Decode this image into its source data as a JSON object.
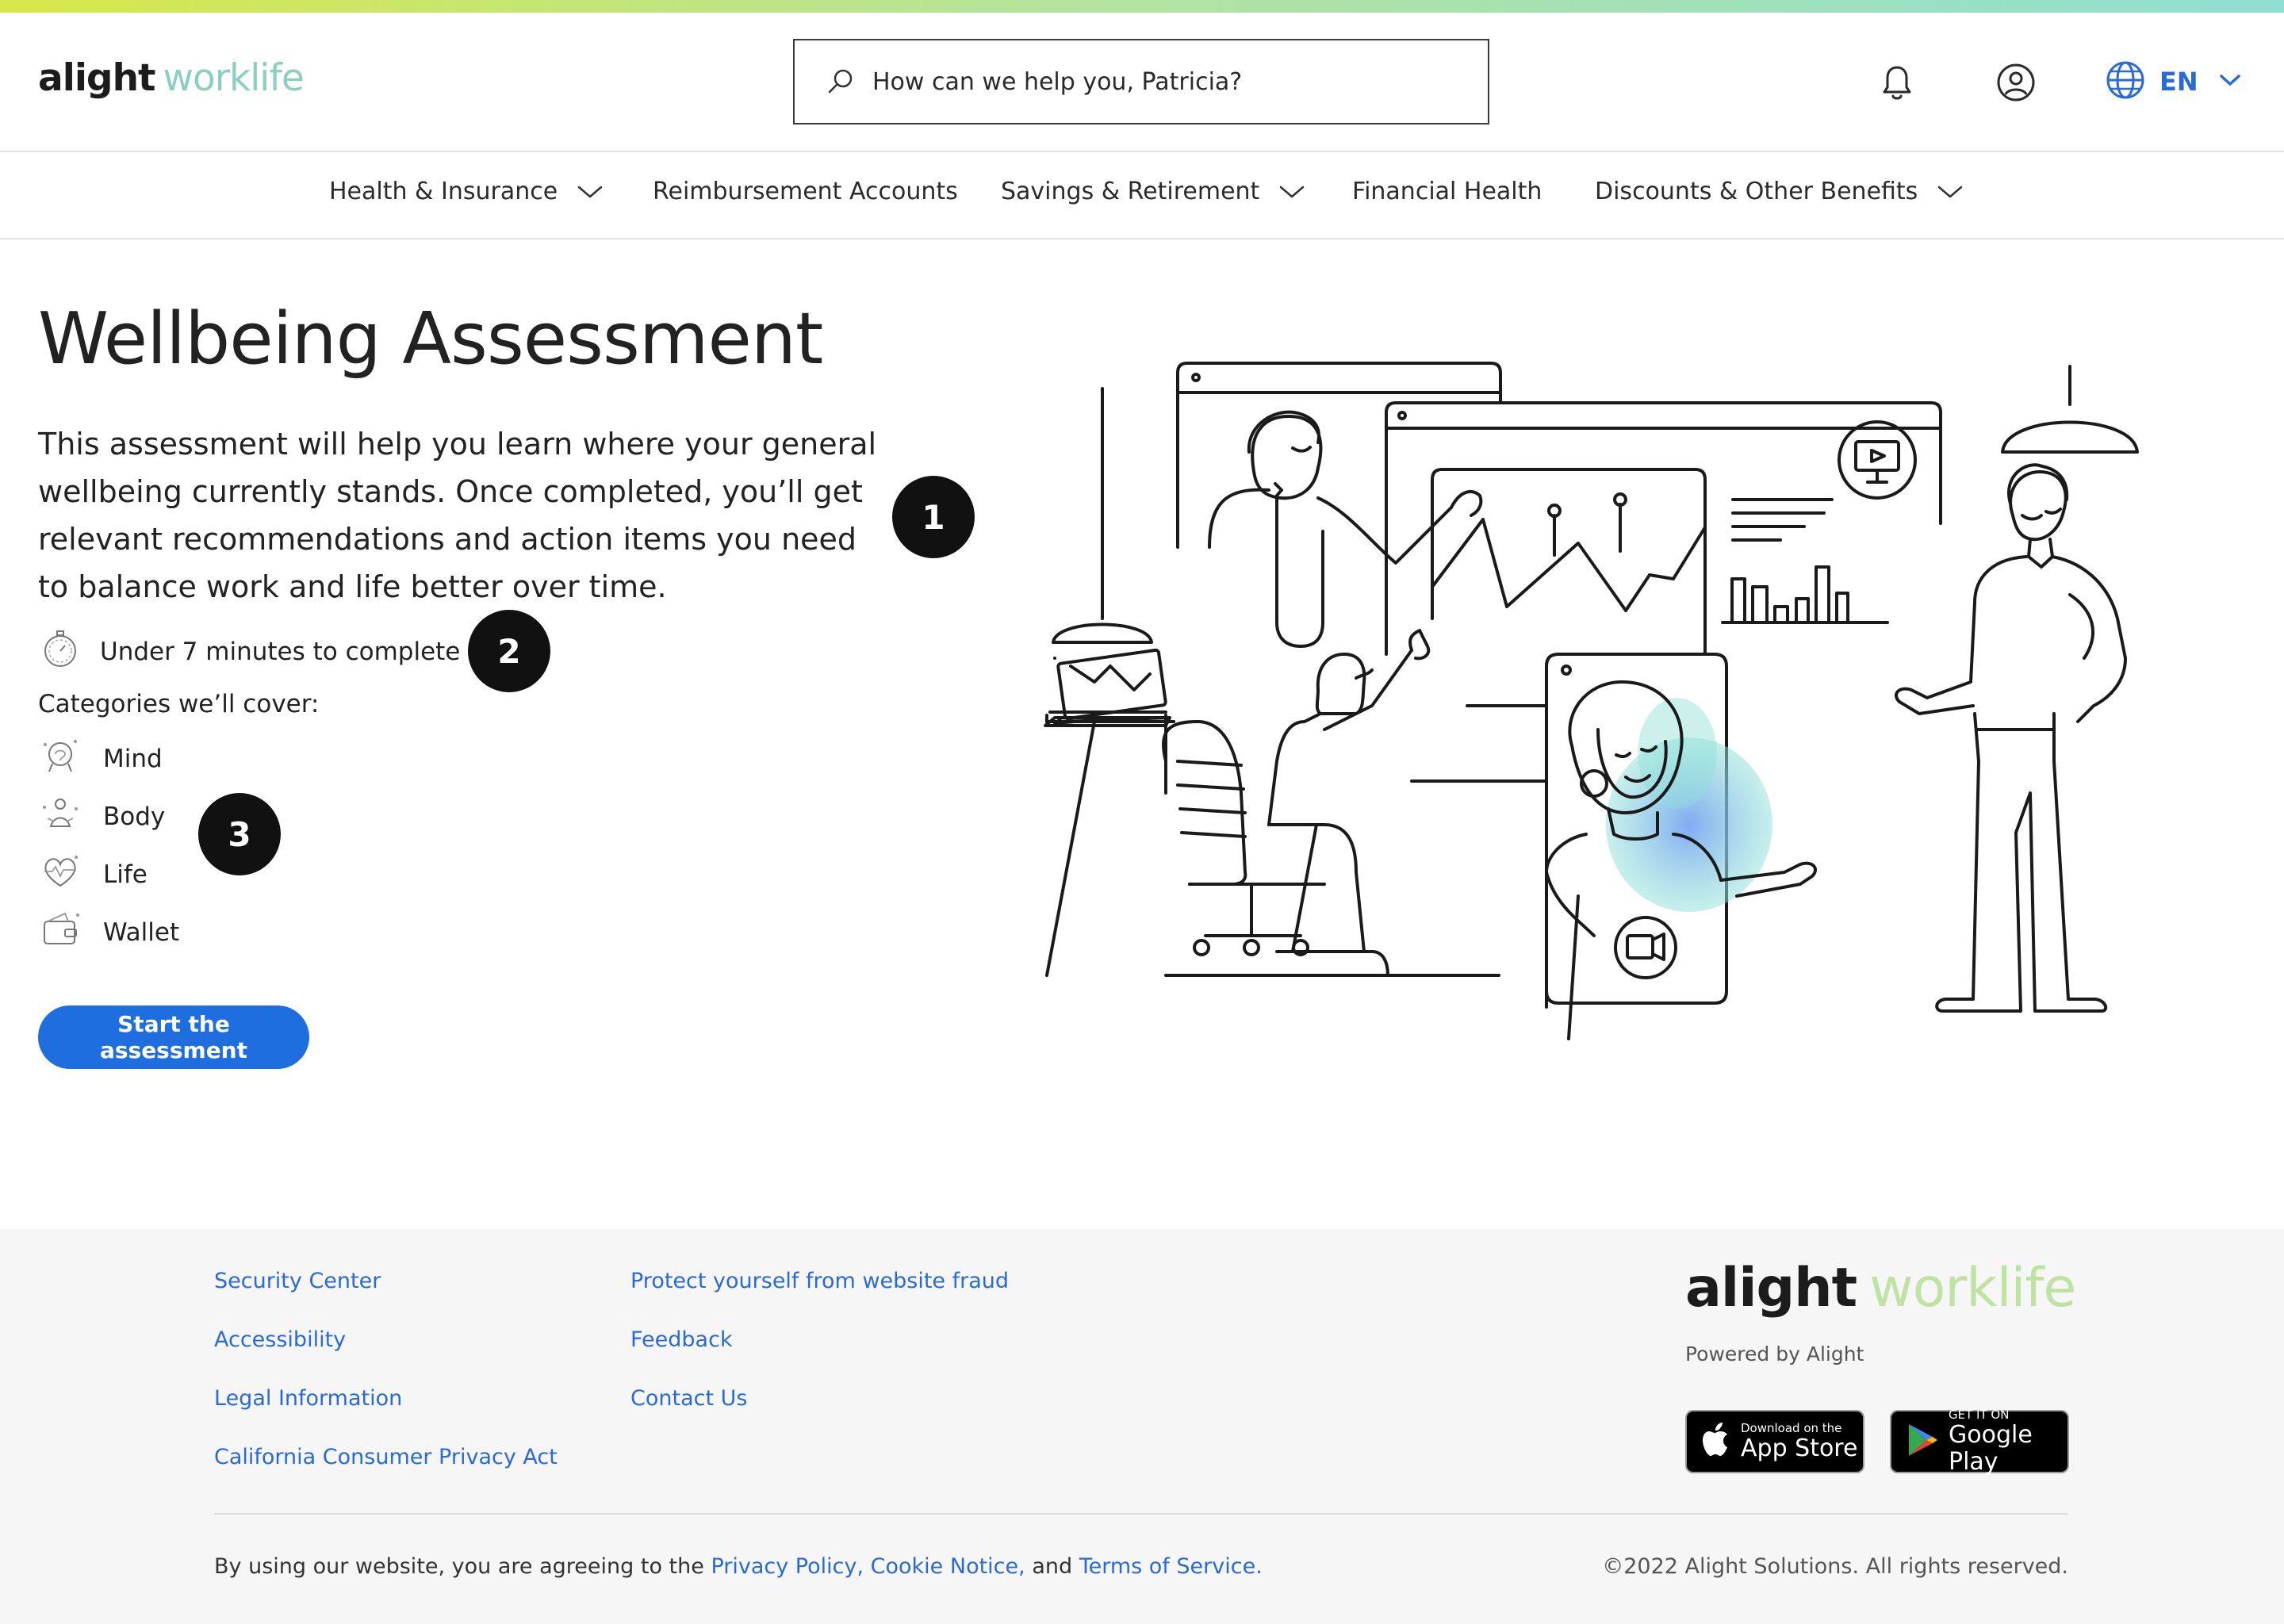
{
  "header": {
    "logo_left": "alight",
    "logo_right": "worklife",
    "search_placeholder": "How can we help you, Patricia?",
    "language": "EN"
  },
  "nav": {
    "items": [
      {
        "label": "Health & Insurance",
        "has_dropdown": true
      },
      {
        "label": "Reimbursement Accounts",
        "has_dropdown": false
      },
      {
        "label": "Savings & Retirement",
        "has_dropdown": true
      },
      {
        "label": "Financial Health",
        "has_dropdown": false
      },
      {
        "label": "Discounts & Other Benefits",
        "has_dropdown": true
      }
    ]
  },
  "main": {
    "title": "Wellbeing Assessment",
    "description": "This assessment will help you learn where your general wellbeing currently stands. Once completed, you’ll get relevant recommendations and action items you need to balance work and life better over time.",
    "duration": "Under 7 minutes to complete",
    "categories_label": "Categories we’ll cover:",
    "categories": [
      {
        "label": "Mind",
        "icon": "mind-icon"
      },
      {
        "label": "Body",
        "icon": "body-icon"
      },
      {
        "label": "Life",
        "icon": "life-icon"
      },
      {
        "label": "Wallet",
        "icon": "wallet-icon"
      }
    ],
    "start_button": "Start the assessment",
    "markers": [
      "1",
      "2",
      "3"
    ]
  },
  "footer": {
    "col1": [
      "Security Center",
      "Accessibility",
      "Legal Information",
      "California Consumer Privacy Act"
    ],
    "col2": [
      "Protect yourself from website fraud",
      "Feedback",
      "Contact Us"
    ],
    "logo_left": "alight",
    "logo_right": "worklife",
    "powered_by": "Powered by Alight",
    "app_store": {
      "small": "Download on the",
      "big": "App Store"
    },
    "google_play": {
      "small": "GET IT ON",
      "big": "Google Play"
    },
    "legal_prefix": "By using our website, you are agreeing to the",
    "privacy_policy": "Privacy Policy,",
    "cookie_notice": "Cookie Notice,",
    "legal_and": "and",
    "terms": "Terms of Service.",
    "copyright": "©2022 Alight Solutions. All rights reserved."
  },
  "colors": {
    "accent": "#1f6ee0",
    "link": "#2a6ad6",
    "marker": "#111111"
  }
}
